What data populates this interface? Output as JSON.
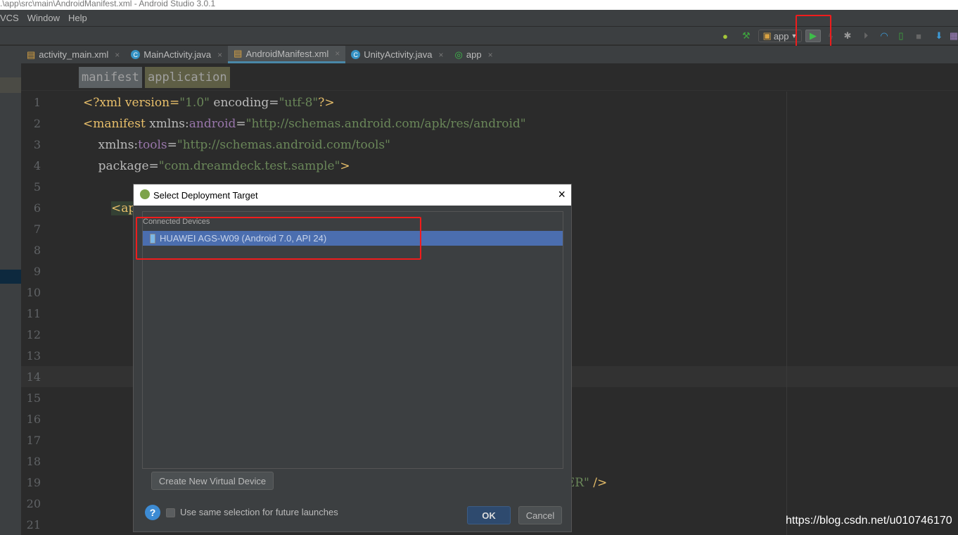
{
  "window": {
    "title": ".\\app\\src\\main\\AndroidManifest.xml - Android Studio 3.0.1"
  },
  "menu": [
    "VCS",
    "Window",
    "Help"
  ],
  "toolbar": {
    "config": "app"
  },
  "tabs": [
    {
      "label": "activity_main.xml",
      "active": false
    },
    {
      "label": "MainActivity.java",
      "active": false
    },
    {
      "label": "AndroidManifest.xml",
      "active": true
    },
    {
      "label": "UnityActivity.java",
      "active": false
    },
    {
      "label": "app",
      "active": false
    }
  ],
  "close_glyph": "×",
  "breadcrumb": [
    "manifest",
    "application"
  ],
  "line_numbers": [
    "1",
    "2",
    "3",
    "4",
    "5",
    "6",
    "7",
    "8",
    "9",
    "10",
    "11",
    "12",
    "13",
    "14",
    "15",
    "16",
    "17",
    "18",
    "19",
    "20",
    "21"
  ],
  "code": {
    "l1a": "<?xml version=",
    "l1b": "\"1.0\"",
    "l1c": " encoding=",
    "l1d": "\"utf-8\"",
    "l1e": "?>",
    "l2a": "<manifest ",
    "l2b": "xmlns:",
    "l2c": "android",
    "l2d": "=",
    "l2e": "\"http://schemas.android.com/apk/res/android\"",
    "l3a": "    xmlns:",
    "l3b": "tools",
    "l3c": "=",
    "l3d": "\"http://schemas.android.com/tools\"",
    "l4a": "    package=",
    "l4b": "\"com.dreamdeck.test.sample\"",
    "l4c": ">",
    "l6": "<ap",
    "l19a": "HER\"",
    "l19b": " />"
  },
  "dialog": {
    "title": "Select Deployment Target",
    "group_label": "Connected Devices",
    "devices": [
      "HUAWEI AGS-W09 (Android 7.0, API 24)"
    ],
    "create_button": "Create New Virtual Device",
    "checkbox_label": "Use same selection for future launches",
    "checkbox_checked": false,
    "help": "?",
    "ok": "OK",
    "cancel": "Cancel",
    "close": "×"
  },
  "watermark": "https://blog.csdn.net/u010746170"
}
